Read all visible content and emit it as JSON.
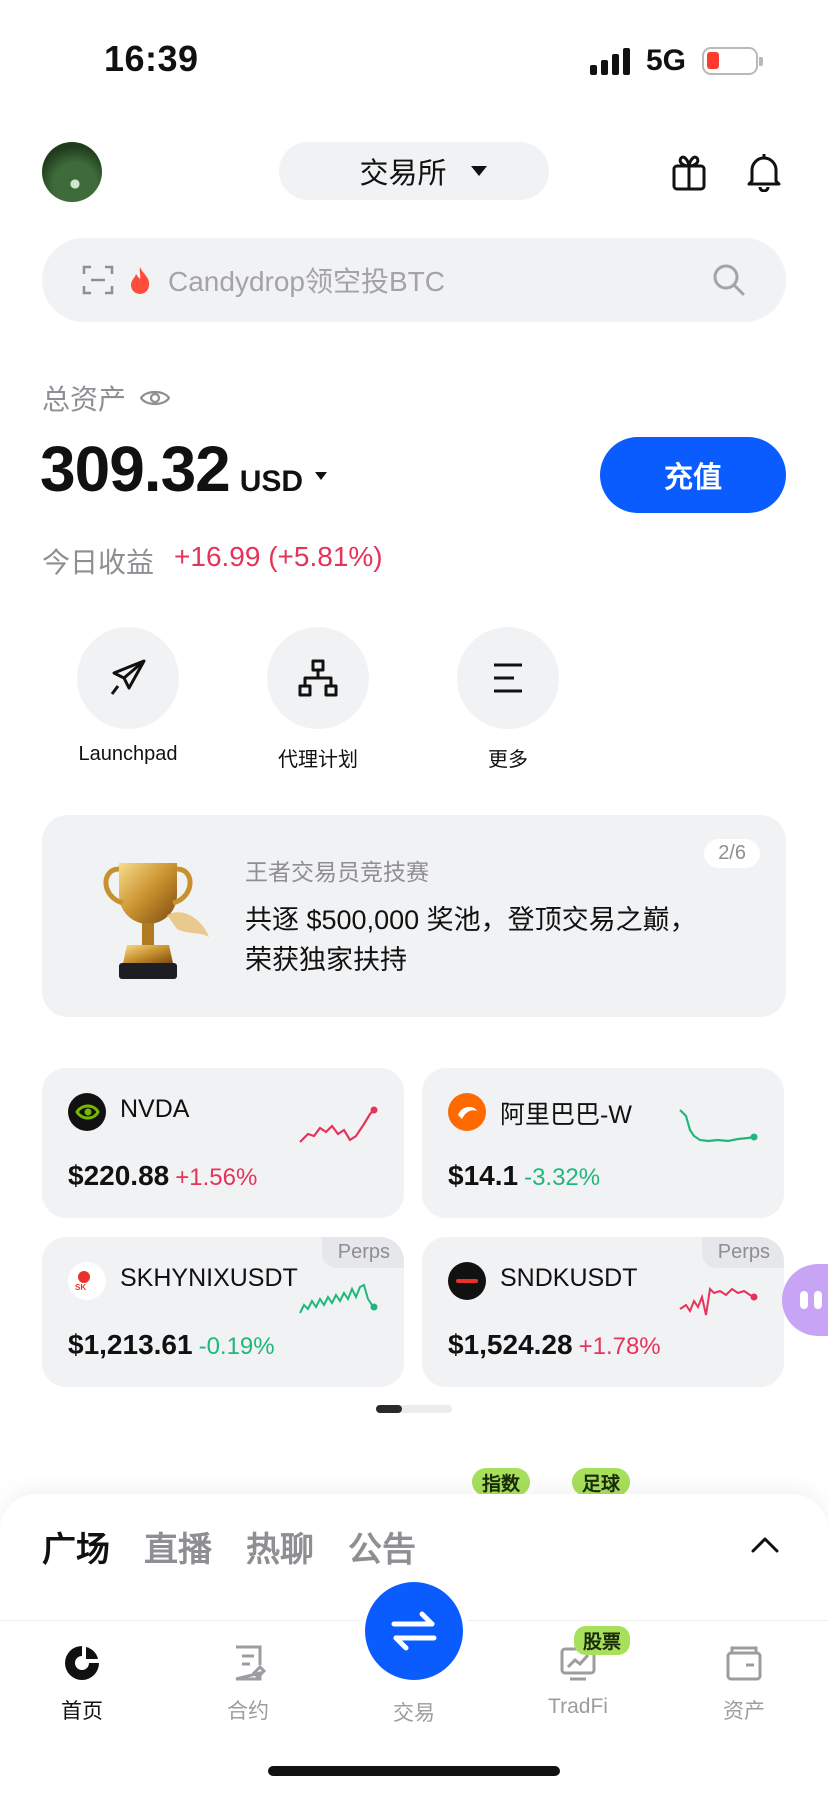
{
  "status_bar": {
    "time": "16:39",
    "network": "5G"
  },
  "header": {
    "exchange_label": "交易所"
  },
  "search": {
    "placeholder": "Candydrop领空投BTC"
  },
  "assets": {
    "label": "总资产",
    "amount": "309.32",
    "currency": "USD",
    "deposit_label": "充值",
    "today_label": "今日收益",
    "today_value": "+16.99 (+5.81%)"
  },
  "shortcuts": [
    {
      "label": "Launchpad",
      "icon": "rocket-icon"
    },
    {
      "label": "代理计划",
      "icon": "org-chart-icon"
    },
    {
      "label": "更多",
      "icon": "menu-icon"
    }
  ],
  "banner": {
    "subtitle": "王者交易员竞技赛",
    "title": "共逐 $500,000 奖池，登顶交易之巅，荣获独家扶持",
    "page": "2/6"
  },
  "markets": [
    {
      "symbol": "NVDA",
      "price": "$220.88",
      "change": "+1.56%",
      "direction": "up",
      "perps": "",
      "logo_color": "#111111"
    },
    {
      "symbol": "阿里巴巴-W",
      "price": "$14.1",
      "change": "-3.32%",
      "direction": "down",
      "perps": "",
      "logo_color": "#ff6a00"
    },
    {
      "symbol": "SKHYNIXUSDT",
      "price": "$1,213.61",
      "change": "-0.19%",
      "direction": "down",
      "perps": "Perps",
      "logo_color": "#ffffff"
    },
    {
      "symbol": "SNDKUSDT",
      "price": "$1,524.28",
      "change": "+1.78%",
      "direction": "up",
      "perps": "Perps",
      "logo_color": "#111111"
    }
  ],
  "tags": {
    "index": "指数",
    "football": "足球"
  },
  "community_tabs": [
    "广场",
    "直播",
    "热聊",
    "公告"
  ],
  "nav": {
    "home": "首页",
    "contract": "合约",
    "trade": "交易",
    "tradfi": "TradFi",
    "assets": "资产",
    "stock_badge": "股票"
  },
  "colors": {
    "accent": "#0a5cff",
    "up": "#e5335a",
    "down": "#1fb87a",
    "badge": "#a7e05b"
  }
}
